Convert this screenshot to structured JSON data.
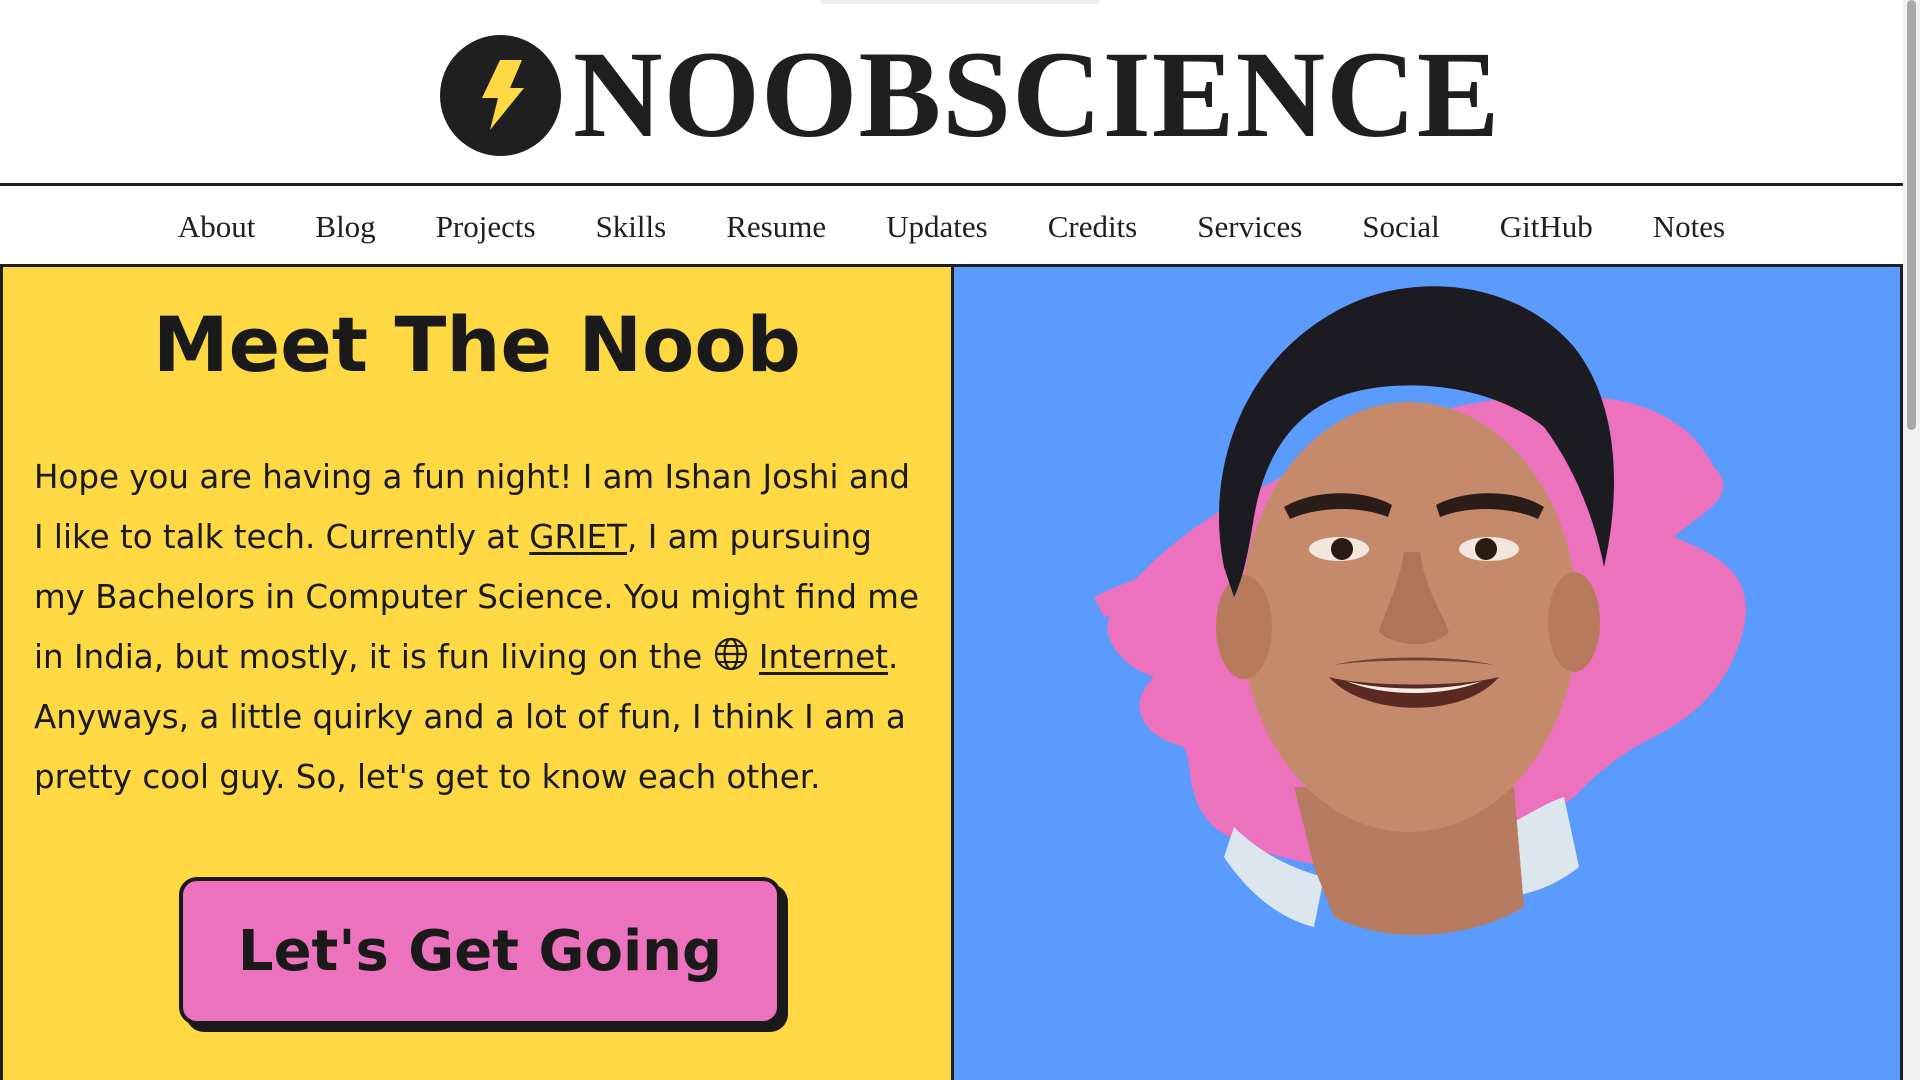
{
  "site": {
    "brand_name": "NOOBSCIENCE",
    "logo_icon": "lightning-bolt-icon",
    "accent_yellow": "#fed944",
    "accent_pink": "#ec72bd",
    "accent_blue": "#5a9bfd",
    "ink": "#1f1f1f"
  },
  "nav": {
    "items": [
      {
        "label": "About"
      },
      {
        "label": "Blog"
      },
      {
        "label": "Projects"
      },
      {
        "label": "Skills"
      },
      {
        "label": "Resume"
      },
      {
        "label": "Updates"
      },
      {
        "label": "Credits"
      },
      {
        "label": "Services"
      },
      {
        "label": "Social"
      },
      {
        "label": "GitHub"
      },
      {
        "label": "Notes"
      }
    ]
  },
  "intro": {
    "title": "Meet The Noob",
    "text_1": "Hope you are having a fun night! I am Ishan Joshi and I like to talk tech. Currently at ",
    "link_griet": "GRIET",
    "text_2": ", I am pursuing my Bachelors in Computer Science. You might find me in India, but mostly, it is fun living on the ",
    "globe_icon": "globe-icon",
    "link_internet": "Internet",
    "text_3": ". Anyways, a little quirky and a lot of fun, I think I am a pretty cool guy. So, let's get to know each other.",
    "cta_label": "Let's Get Going"
  },
  "hero": {
    "image": "portrait-photo"
  }
}
